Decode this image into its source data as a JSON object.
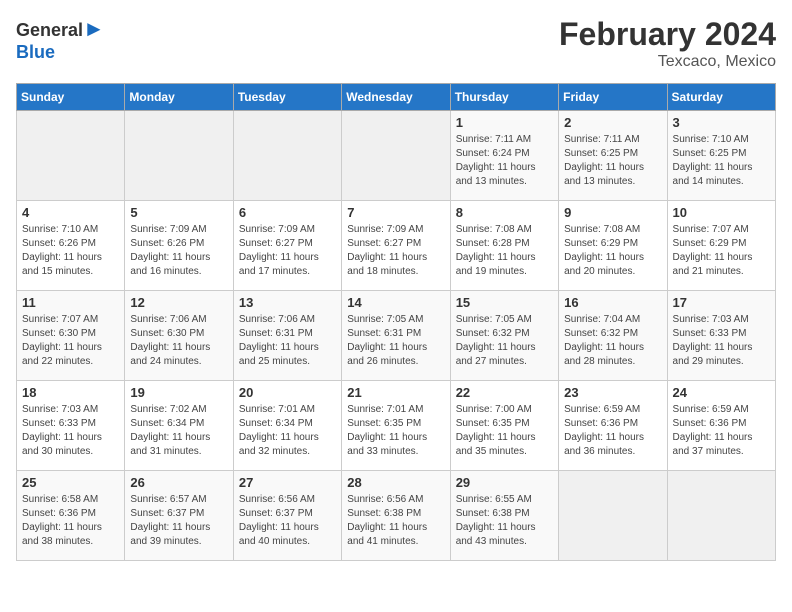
{
  "header": {
    "logo_general": "General",
    "logo_blue": "Blue",
    "month_title": "February 2024",
    "location": "Texcaco, Mexico"
  },
  "days_of_week": [
    "Sunday",
    "Monday",
    "Tuesday",
    "Wednesday",
    "Thursday",
    "Friday",
    "Saturday"
  ],
  "weeks": [
    [
      {
        "day": "",
        "info": ""
      },
      {
        "day": "",
        "info": ""
      },
      {
        "day": "",
        "info": ""
      },
      {
        "day": "",
        "info": ""
      },
      {
        "day": "1",
        "info": "Sunrise: 7:11 AM\nSunset: 6:24 PM\nDaylight: 11 hours\nand 13 minutes."
      },
      {
        "day": "2",
        "info": "Sunrise: 7:11 AM\nSunset: 6:25 PM\nDaylight: 11 hours\nand 13 minutes."
      },
      {
        "day": "3",
        "info": "Sunrise: 7:10 AM\nSunset: 6:25 PM\nDaylight: 11 hours\nand 14 minutes."
      }
    ],
    [
      {
        "day": "4",
        "info": "Sunrise: 7:10 AM\nSunset: 6:26 PM\nDaylight: 11 hours\nand 15 minutes."
      },
      {
        "day": "5",
        "info": "Sunrise: 7:09 AM\nSunset: 6:26 PM\nDaylight: 11 hours\nand 16 minutes."
      },
      {
        "day": "6",
        "info": "Sunrise: 7:09 AM\nSunset: 6:27 PM\nDaylight: 11 hours\nand 17 minutes."
      },
      {
        "day": "7",
        "info": "Sunrise: 7:09 AM\nSunset: 6:27 PM\nDaylight: 11 hours\nand 18 minutes."
      },
      {
        "day": "8",
        "info": "Sunrise: 7:08 AM\nSunset: 6:28 PM\nDaylight: 11 hours\nand 19 minutes."
      },
      {
        "day": "9",
        "info": "Sunrise: 7:08 AM\nSunset: 6:29 PM\nDaylight: 11 hours\nand 20 minutes."
      },
      {
        "day": "10",
        "info": "Sunrise: 7:07 AM\nSunset: 6:29 PM\nDaylight: 11 hours\nand 21 minutes."
      }
    ],
    [
      {
        "day": "11",
        "info": "Sunrise: 7:07 AM\nSunset: 6:30 PM\nDaylight: 11 hours\nand 22 minutes."
      },
      {
        "day": "12",
        "info": "Sunrise: 7:06 AM\nSunset: 6:30 PM\nDaylight: 11 hours\nand 24 minutes."
      },
      {
        "day": "13",
        "info": "Sunrise: 7:06 AM\nSunset: 6:31 PM\nDaylight: 11 hours\nand 25 minutes."
      },
      {
        "day": "14",
        "info": "Sunrise: 7:05 AM\nSunset: 6:31 PM\nDaylight: 11 hours\nand 26 minutes."
      },
      {
        "day": "15",
        "info": "Sunrise: 7:05 AM\nSunset: 6:32 PM\nDaylight: 11 hours\nand 27 minutes."
      },
      {
        "day": "16",
        "info": "Sunrise: 7:04 AM\nSunset: 6:32 PM\nDaylight: 11 hours\nand 28 minutes."
      },
      {
        "day": "17",
        "info": "Sunrise: 7:03 AM\nSunset: 6:33 PM\nDaylight: 11 hours\nand 29 minutes."
      }
    ],
    [
      {
        "day": "18",
        "info": "Sunrise: 7:03 AM\nSunset: 6:33 PM\nDaylight: 11 hours\nand 30 minutes."
      },
      {
        "day": "19",
        "info": "Sunrise: 7:02 AM\nSunset: 6:34 PM\nDaylight: 11 hours\nand 31 minutes."
      },
      {
        "day": "20",
        "info": "Sunrise: 7:01 AM\nSunset: 6:34 PM\nDaylight: 11 hours\nand 32 minutes."
      },
      {
        "day": "21",
        "info": "Sunrise: 7:01 AM\nSunset: 6:35 PM\nDaylight: 11 hours\nand 33 minutes."
      },
      {
        "day": "22",
        "info": "Sunrise: 7:00 AM\nSunset: 6:35 PM\nDaylight: 11 hours\nand 35 minutes."
      },
      {
        "day": "23",
        "info": "Sunrise: 6:59 AM\nSunset: 6:36 PM\nDaylight: 11 hours\nand 36 minutes."
      },
      {
        "day": "24",
        "info": "Sunrise: 6:59 AM\nSunset: 6:36 PM\nDaylight: 11 hours\nand 37 minutes."
      }
    ],
    [
      {
        "day": "25",
        "info": "Sunrise: 6:58 AM\nSunset: 6:36 PM\nDaylight: 11 hours\nand 38 minutes."
      },
      {
        "day": "26",
        "info": "Sunrise: 6:57 AM\nSunset: 6:37 PM\nDaylight: 11 hours\nand 39 minutes."
      },
      {
        "day": "27",
        "info": "Sunrise: 6:56 AM\nSunset: 6:37 PM\nDaylight: 11 hours\nand 40 minutes."
      },
      {
        "day": "28",
        "info": "Sunrise: 6:56 AM\nSunset: 6:38 PM\nDaylight: 11 hours\nand 41 minutes."
      },
      {
        "day": "29",
        "info": "Sunrise: 6:55 AM\nSunset: 6:38 PM\nDaylight: 11 hours\nand 43 minutes."
      },
      {
        "day": "",
        "info": ""
      },
      {
        "day": "",
        "info": ""
      }
    ]
  ]
}
